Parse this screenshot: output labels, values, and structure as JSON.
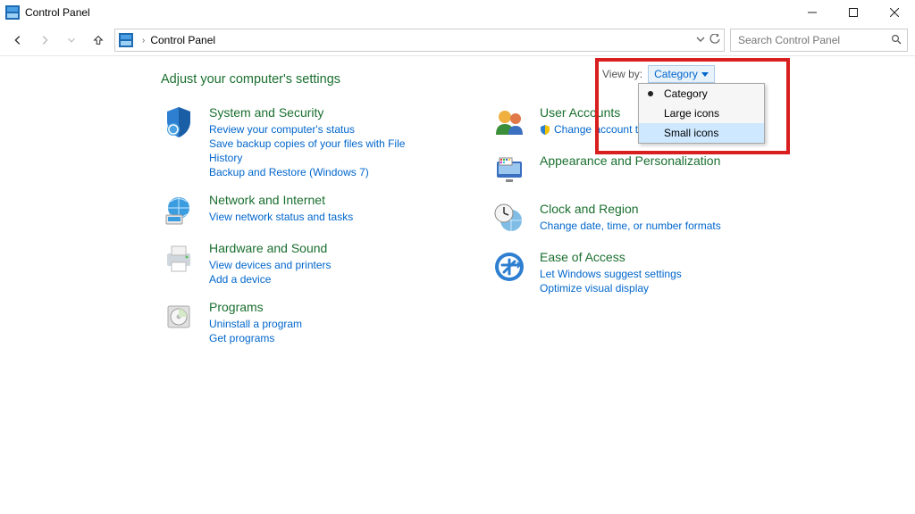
{
  "window": {
    "title": "Control Panel"
  },
  "breadcrumb": {
    "root": "Control Panel"
  },
  "search": {
    "placeholder": "Search Control Panel"
  },
  "page": {
    "heading": "Adjust your computer's settings"
  },
  "viewby": {
    "label": "View by:",
    "current": "Category",
    "options": [
      "Category",
      "Large icons",
      "Small icons"
    ],
    "selected_index": 0,
    "highlighted_index": 2
  },
  "categories": {
    "left": [
      {
        "title": "System and Security",
        "links": [
          "Review your computer's status",
          "Save backup copies of your files with File History",
          "Backup and Restore (Windows 7)"
        ]
      },
      {
        "title": "Network and Internet",
        "links": [
          "View network status and tasks"
        ]
      },
      {
        "title": "Hardware and Sound",
        "links": [
          "View devices and printers",
          "Add a device"
        ]
      },
      {
        "title": "Programs",
        "links": [
          "Uninstall a program",
          "Get programs"
        ]
      }
    ],
    "right": [
      {
        "title": "User Accounts",
        "links": [
          "Change account type"
        ],
        "shield_on": [
          0
        ]
      },
      {
        "title": "Appearance and Personalization",
        "links": []
      },
      {
        "title": "Clock and Region",
        "links": [
          "Change date, time, or number formats"
        ]
      },
      {
        "title": "Ease of Access",
        "links": [
          "Let Windows suggest settings",
          "Optimize visual display"
        ]
      }
    ]
  }
}
